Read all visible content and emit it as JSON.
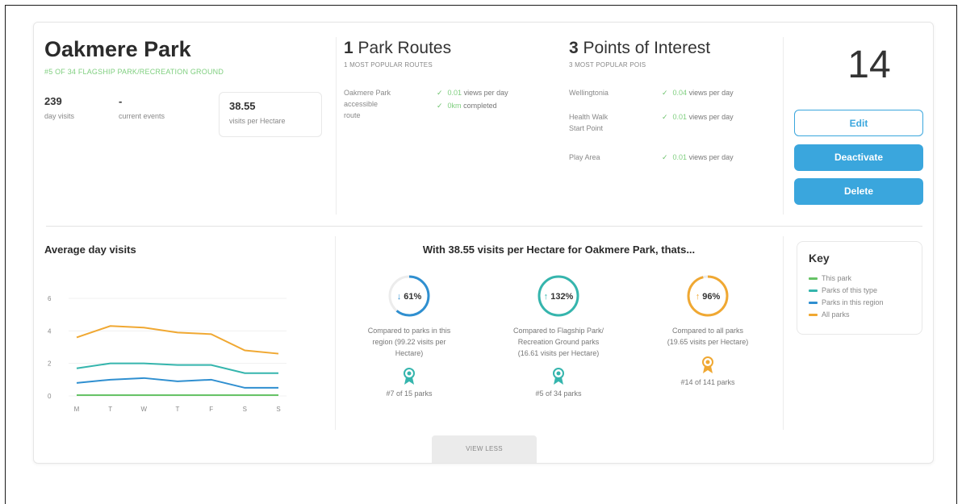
{
  "park": {
    "name": "Oakmere Park",
    "subtitle": "#5 OF 34 FLAGSHIP PARK/RECREATION GROUND",
    "day_visits_value": "239",
    "day_visits_label": "day visits",
    "current_events_value": "-",
    "current_events_label": "current events",
    "hectare_value": "38.55",
    "hectare_label": "visits per Hectare"
  },
  "routes": {
    "count": "1",
    "title": "Park Routes",
    "subtitle": "1 MOST POPULAR ROUTES",
    "items": [
      {
        "name_lines": [
          "Oakmere Park",
          "accessible",
          "route"
        ],
        "stat1_value": "0.01",
        "stat1_label": "views per day",
        "stat2_value": "0km",
        "stat2_label": "completed"
      }
    ]
  },
  "pois": {
    "count": "3",
    "title": "Points of Interest",
    "subtitle": "3 MOST POPULAR POIS",
    "items": [
      {
        "name_lines": [
          "Wellingtonia"
        ],
        "value": "0.04",
        "label": "views per day"
      },
      {
        "name_lines": [
          "Health Walk",
          "Start Point"
        ],
        "value": "0.01",
        "label": "views per day"
      },
      {
        "name_lines": [
          "Play Area"
        ],
        "value": "0.01",
        "label": "views per day"
      }
    ]
  },
  "actions": {
    "count": "14",
    "edit": "Edit",
    "deactivate": "Deactivate",
    "delete": "Delete"
  },
  "chart_data": {
    "type": "line",
    "title": "Average day visits",
    "categories": [
      "M",
      "T",
      "W",
      "T",
      "F",
      "S",
      "S"
    ],
    "yticks": [
      0,
      2,
      4,
      6
    ],
    "ylim": [
      0,
      6
    ],
    "grid": true,
    "series": [
      {
        "color": "#f0a832",
        "values": [
          3.6,
          4.3,
          4.2,
          3.9,
          3.8,
          2.8,
          2.6
        ]
      },
      {
        "color": "#35b5ad",
        "values": [
          1.7,
          2.0,
          2.0,
          1.9,
          1.9,
          1.4,
          1.4
        ]
      },
      {
        "color": "#2f8fd0",
        "values": [
          0.8,
          1.0,
          1.1,
          0.9,
          1.0,
          0.5,
          0.5
        ]
      },
      {
        "color": "#66c266",
        "values": [
          0.05,
          0.05,
          0.05,
          0.05,
          0.05,
          0.05,
          0.05
        ]
      }
    ]
  },
  "comparison": {
    "title": "With 38.55 visits per Hectare for Oakmere Park, thats...",
    "items": [
      {
        "arrow": "↓",
        "percent": "61%",
        "fraction": 0.61,
        "color": "#2f8fd0",
        "desc": [
          "Compared to parks in this",
          "region (99.22 visits per",
          "Hectare)"
        ],
        "rank": "#7 of 15 parks",
        "badge_color": "#35b5ad"
      },
      {
        "arrow": "↑",
        "percent": "132%",
        "fraction": 1.0,
        "color": "#35b5ad",
        "desc": [
          "Compared to Flagship Park/",
          "Recreation Ground parks",
          "(16.61 visits per Hectare)"
        ],
        "rank": "#5 of 34 parks",
        "badge_color": "#35b5ad"
      },
      {
        "arrow": "↑",
        "percent": "96%",
        "fraction": 0.96,
        "color": "#f0a832",
        "desc": [
          "Compared to all parks",
          "(19.65 visits per Hectare)"
        ],
        "rank": "#14 of 141 parks",
        "badge_color": "#f0a832"
      }
    ]
  },
  "key": {
    "title": "Key",
    "items": [
      {
        "label": "This park",
        "color": "#66c266"
      },
      {
        "label": "Parks of this type",
        "color": "#35b5ad"
      },
      {
        "label": "Parks in this region",
        "color": "#2f8fd0"
      },
      {
        "label": "All parks",
        "color": "#f0a832"
      }
    ]
  },
  "footer": {
    "view_less": "VIEW LESS"
  }
}
